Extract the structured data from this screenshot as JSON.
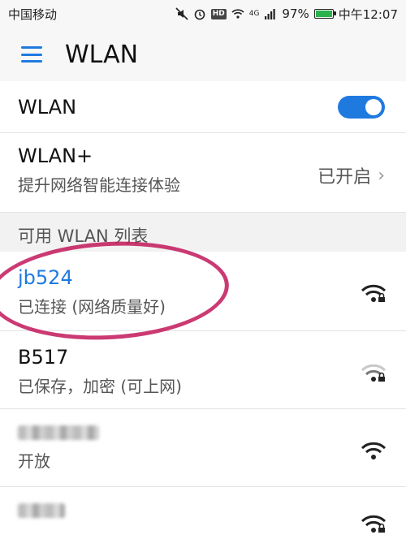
{
  "statusbar": {
    "carrier": "中国移动",
    "battery": "97%",
    "time": "中午12:07",
    "hd": "HD",
    "network": "4G"
  },
  "appbar": {
    "title": "WLAN"
  },
  "wlan_toggle": {
    "label": "WLAN",
    "state": "on"
  },
  "wlan_plus": {
    "title": "WLAN+",
    "subtitle": "提升网络智能连接体验",
    "status": "已开启"
  },
  "section": {
    "label": "可用 WLAN 列表"
  },
  "networks": [
    {
      "name": "jb524",
      "status": "已连接 (网络质量好)",
      "locked": true,
      "connected": true
    },
    {
      "name": "B517",
      "status": "已保存，加密 (可上网)",
      "locked": true,
      "connected": false
    },
    {
      "name": "",
      "status": "开放",
      "locked": false,
      "connected": false
    },
    {
      "name": "",
      "status": "",
      "locked": true,
      "connected": false
    }
  ],
  "colors": {
    "accent": "#1f7ae0",
    "annotation": "#c2185b"
  }
}
